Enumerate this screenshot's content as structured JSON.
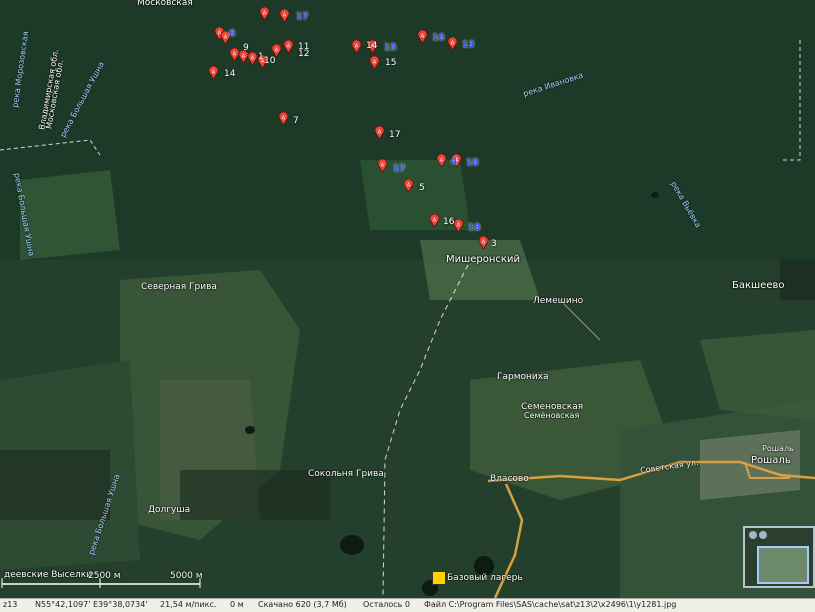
{
  "map": {
    "towns": [
      {
        "key": "misheronsky",
        "name": "Мишеронский"
      },
      {
        "key": "bakshee",
        "name": "Бакшеево"
      },
      {
        "key": "roshal",
        "name": "Рошаль"
      }
    ],
    "places": [
      "Северная Грива",
      "Лемешино",
      "Гармониха",
      "Семеновская",
      "Семёновская",
      "Сокольня Грива",
      "Власово",
      "Долгуша",
      "Рошаль",
      "деевские Выселки",
      "Московская"
    ],
    "rivers": [
      "река Ивановка",
      "река Вьёвка",
      "река Большая Ушна",
      "река Большая Ушна",
      "река Большая Ушна",
      "река Морозовская",
      "Владимирская обл.",
      "Московская обл."
    ],
    "roads": [
      "Советская ул."
    ],
    "camp_label": "Базовый лагерь",
    "marker_numbers": [
      "17",
      "6",
      "9",
      "1",
      "10",
      "11",
      "12",
      "14",
      "15",
      "16",
      "13",
      "14",
      "15",
      "7",
      "17",
      "5",
      "4",
      "18",
      "17",
      "16",
      "18",
      "3",
      "18",
      "2"
    ],
    "scale": {
      "a": "2500 м",
      "b": "5000 м"
    }
  },
  "status": {
    "zoom": "z13",
    "coords": "N55°42,1097' E39°38,0734'",
    "resolution": "21,54 м/пикс.",
    "distance": "0 м",
    "downloaded": "Скачано 620 (3,7 Мб)",
    "remaining": "Осталось 0",
    "file": "Файл C:\\Program Files\\SAS\\cache\\sat\\z13\\2\\x2496\\1\\y1281.jpg"
  }
}
